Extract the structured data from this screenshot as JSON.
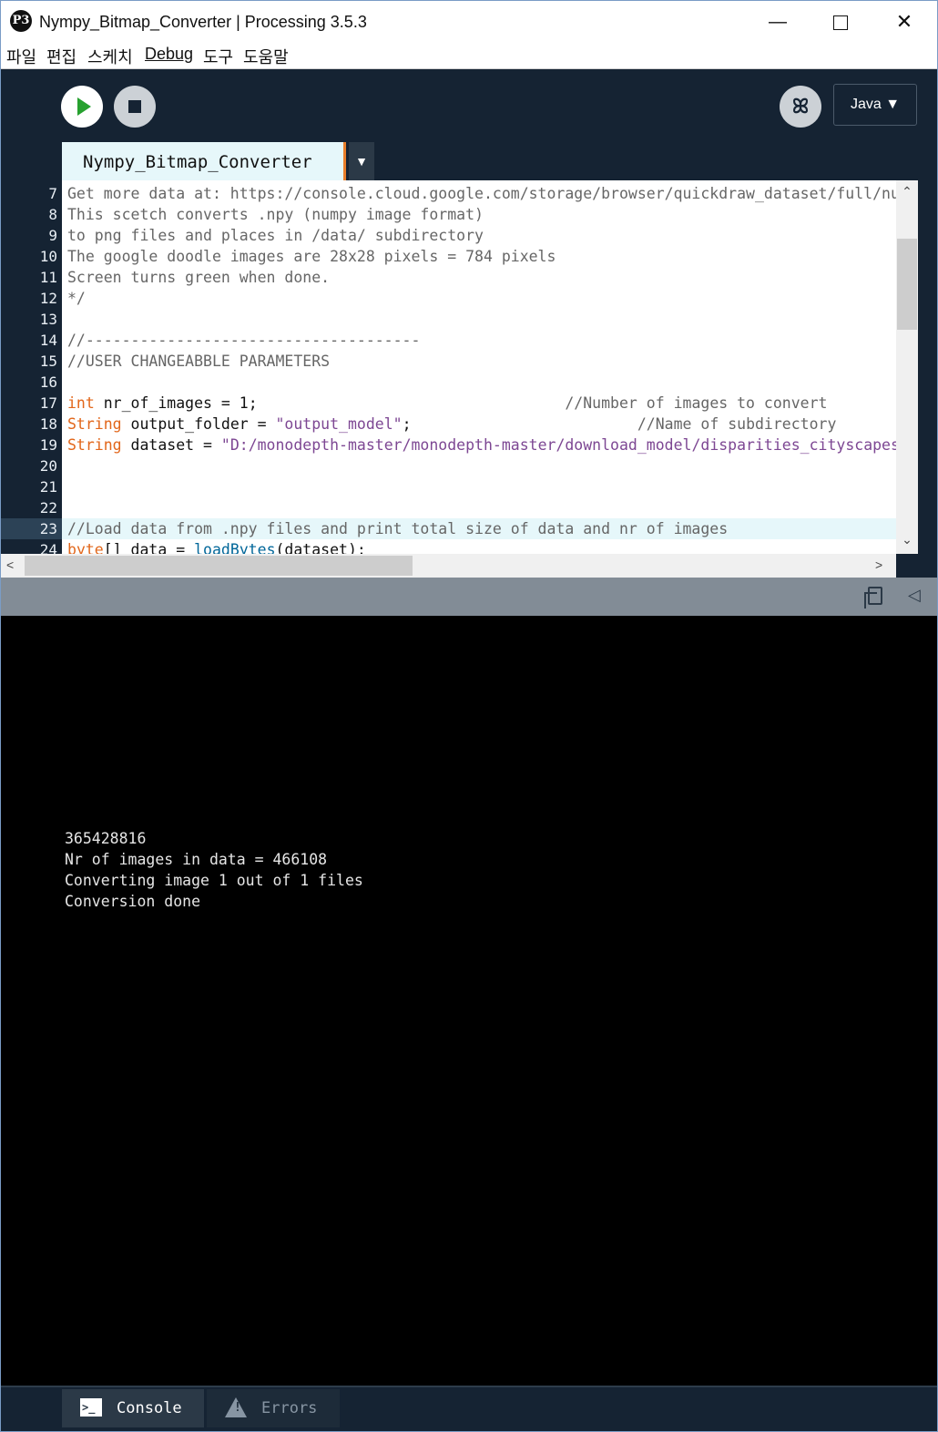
{
  "window": {
    "title": "Nympy_Bitmap_Converter | Processing 3.5.3",
    "minimize": "—",
    "close": "✕"
  },
  "menu": [
    "파일",
    "편집",
    "스케치",
    "Debug",
    "도구",
    "도움말"
  ],
  "toolbar": {
    "mode": "Java ▼",
    "debug_glyph": "ꕤ"
  },
  "tabs": {
    "active": "Nympy_Bitmap_Converter",
    "menu_arrow": "▼"
  },
  "editor": {
    "highlighted_line": 23,
    "lines": [
      {
        "n": "7",
        "segs": [
          [
            "cm",
            "Get more data at: https://console.cloud.google.com/storage/browser/quickdraw_dataset/full/numpy_bitmap"
          ]
        ]
      },
      {
        "n": "8",
        "segs": [
          [
            "cm",
            "This scetch converts .npy (numpy image format)"
          ]
        ]
      },
      {
        "n": "9",
        "segs": [
          [
            "cm",
            "to png files and places in /data/ subdirectory"
          ]
        ]
      },
      {
        "n": "10",
        "segs": [
          [
            "cm",
            "The google doodle images are 28x28 pixels = 784 pixels"
          ]
        ]
      },
      {
        "n": "11",
        "segs": [
          [
            "cm",
            "Screen turns green when done."
          ]
        ]
      },
      {
        "n": "12",
        "segs": [
          [
            "cm",
            "*/"
          ]
        ]
      },
      {
        "n": "13",
        "segs": []
      },
      {
        "n": "14",
        "segs": [
          [
            "cm",
            "//-------------------------------------"
          ]
        ]
      },
      {
        "n": "15",
        "segs": [
          [
            "cm",
            "//USER CHANGEABBLE PARAMETERS"
          ]
        ]
      },
      {
        "n": "16",
        "segs": []
      },
      {
        "n": "17",
        "segs": [
          [
            "kw",
            "int"
          ],
          [
            "",
            " nr_of_images = 1;                                  "
          ],
          [
            "cm",
            "//Number of images to convert"
          ]
        ]
      },
      {
        "n": "18",
        "segs": [
          [
            "kw",
            "String"
          ],
          [
            "",
            " output_folder = "
          ],
          [
            "str",
            "\"output_model\""
          ],
          [
            "",
            ";                         "
          ],
          [
            "cm",
            "//Name of subdirectory"
          ]
        ]
      },
      {
        "n": "19",
        "segs": [
          [
            "kw",
            "String"
          ],
          [
            "",
            " dataset = "
          ],
          [
            "str",
            "\"D:/monodepth-master/monodepth-master/download_model/disparities_cityscapes.npy\""
          ],
          [
            "",
            ";"
          ]
        ]
      },
      {
        "n": "20",
        "segs": []
      },
      {
        "n": "21",
        "segs": []
      },
      {
        "n": "22",
        "segs": []
      },
      {
        "n": "23",
        "segs": [
          [
            "cm",
            "//Load data from .npy files and print total size of data and nr of images"
          ]
        ]
      },
      {
        "n": "24",
        "segs": [
          [
            "kw",
            "byte"
          ],
          [
            "",
            "[] data = "
          ],
          [
            "fn",
            "loadBytes"
          ],
          [
            "",
            "(dataset);"
          ]
        ]
      }
    ]
  },
  "scroll": {
    "up": "⌃",
    "down": "⌄",
    "left": "<",
    "right": ">"
  },
  "console": {
    "lines": [
      "365428816",
      "Nr of images in data = 466108",
      "Converting image 1 out of 1 files",
      "Conversion done"
    ]
  },
  "footer": {
    "console_tab": "Console",
    "errors_tab": "Errors",
    "console_icon": ">_",
    "warning_icon": "!"
  },
  "colors": {
    "toolbar_bg": "#152333",
    "tab_active_bg": "#e6f7fa",
    "keyword": "#e2661a",
    "string": "#7d4793",
    "comment": "#666666",
    "function": "#006699",
    "run_green": "#27a12f"
  }
}
